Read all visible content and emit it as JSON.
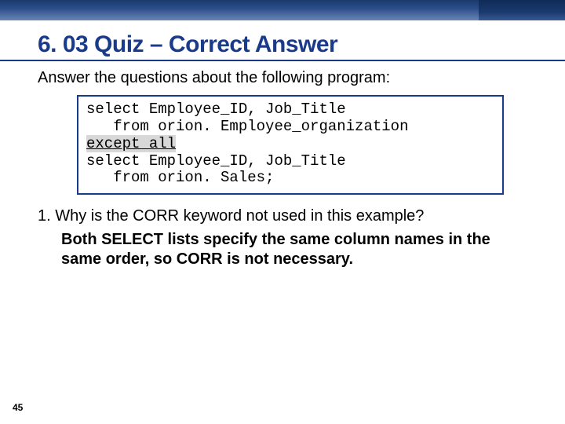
{
  "title": "6. 03 Quiz – Correct Answer",
  "intro": "Answer the questions about the following program:",
  "code": {
    "l1": "select Employee_ID, Job_Title",
    "l2": "   from orion. Employee_organization",
    "hl": "except all",
    "l3": "select Employee_ID, Job_Title",
    "l4": "   from orion. Sales;"
  },
  "question": "1. Why is the CORR keyword not used in this example?",
  "answer": "Both SELECT lists specify the same column names in the same order, so CORR is not necessary.",
  "page": "45"
}
